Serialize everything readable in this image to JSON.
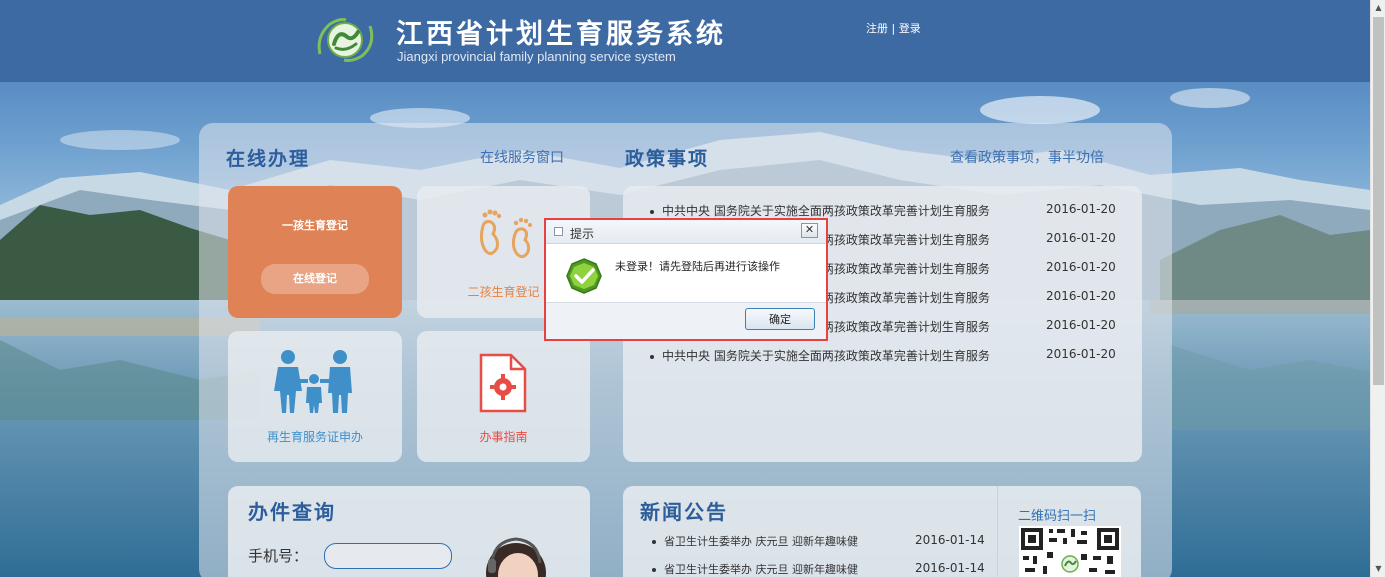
{
  "header": {
    "title_cn": "江西省计划生育服务系统",
    "title_en": "Jiangxi provincial family planning service system",
    "register": "注册",
    "separator": " | ",
    "login": "登录",
    "logo_icon": "family-planning-logo-icon"
  },
  "online": {
    "title": "在线办理",
    "link": "在线服务窗口",
    "tiles": [
      {
        "label": "一孩生育登记",
        "button": "在线登记",
        "icon": "none"
      },
      {
        "label": "二孩生育登记",
        "icon": "footprints-icon"
      },
      {
        "label": "再生育服务证申办",
        "icon": "family-icon"
      },
      {
        "label": "办事指南",
        "icon": "document-gear-icon"
      }
    ]
  },
  "policy": {
    "title": "政策事项",
    "link": "查看政策事项，事半功倍",
    "items": [
      {
        "text": "中共中央 国务院关于实施全面两孩政策改革完善计划生育服务",
        "date": "2016-01-20"
      },
      {
        "text": "中共中央 国务院关于实施全面两孩政策改革完善计划生育服务",
        "date": "2016-01-20"
      },
      {
        "text": "中共中央 国务院关于实施全面两孩政策改革完善计划生育服务",
        "date": "2016-01-20"
      },
      {
        "text": "中共中央 国务院关于实施全面两孩政策改革完善计划生育服务",
        "date": "2016-01-20"
      },
      {
        "text": "中共中央 国务院关于实施全面两孩政策改革完善计划生育服务",
        "date": "2016-01-20"
      },
      {
        "text": "中共中央 国务院关于实施全面两孩政策改革完善计划生育服务",
        "date": "2016-01-20"
      }
    ]
  },
  "query": {
    "title": "办件查询",
    "phone_label": "手机号：",
    "phone_value": ""
  },
  "news": {
    "title": "新闻公告",
    "items": [
      {
        "text": "省卫生计生委举办 庆元旦 迎新年趣味健",
        "date": "2016-01-14"
      },
      {
        "text": "省卫生计生委举办 庆元旦 迎新年趣味健",
        "date": "2016-01-14"
      }
    ],
    "qr_title": "二维码扫一扫",
    "qr_icon": "qr-code-icon"
  },
  "dialog": {
    "title": "提示",
    "message": "未登录！请先登陆后再进行该操作",
    "ok": "确定",
    "close": "✕"
  },
  "colors": {
    "header": "#3e6aa4",
    "accent_orange": "#df8256",
    "icon_red": "#e84c46",
    "section_blue": "#2c5d9c",
    "dialog_highlight": "#e8413f"
  }
}
